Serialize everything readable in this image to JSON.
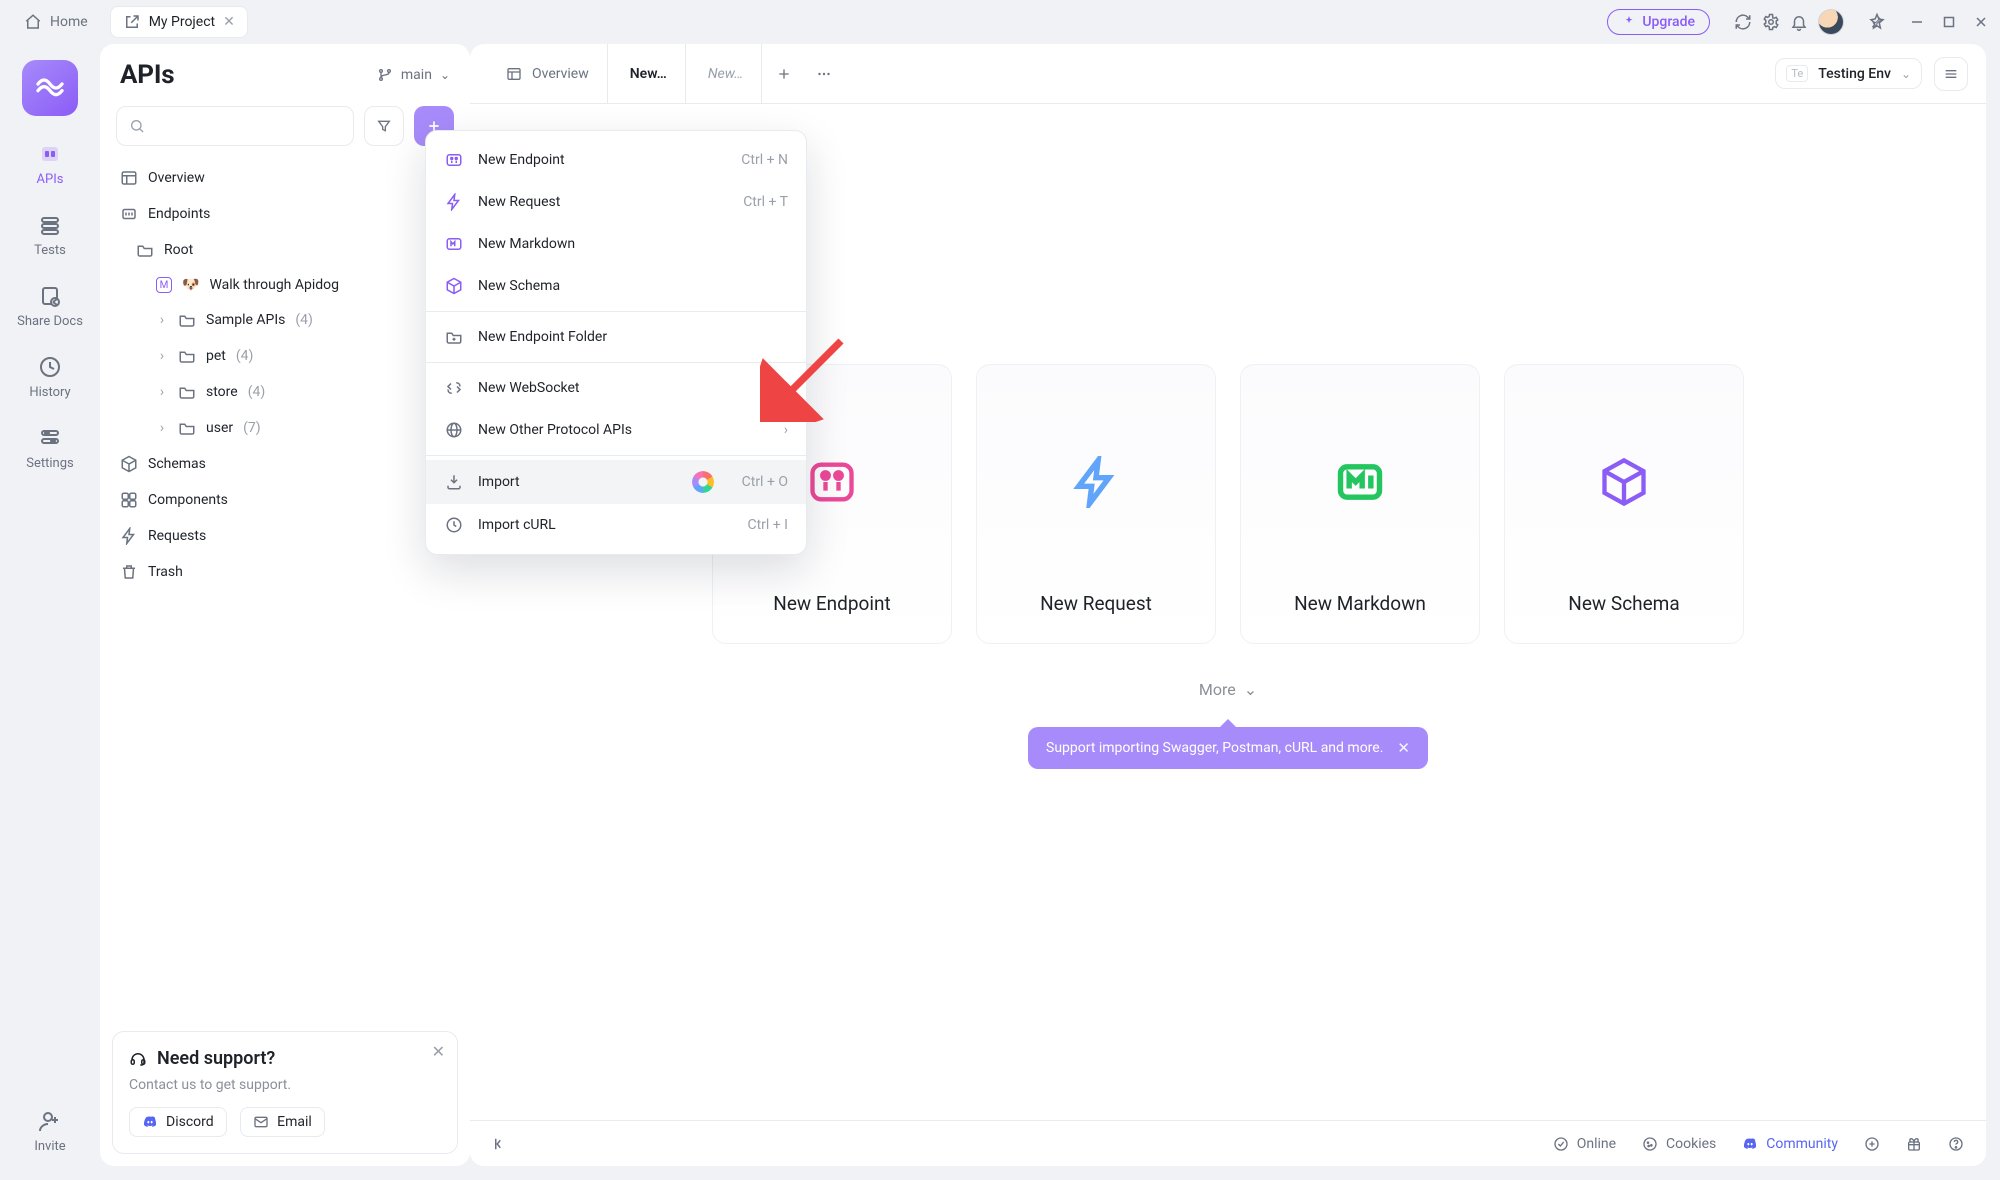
{
  "titlebar": {
    "home": "Home",
    "project_tab": "My Project",
    "upgrade": "Upgrade"
  },
  "leftrail": {
    "apis": "APIs",
    "tests": "Tests",
    "share_docs": "Share Docs",
    "history": "History",
    "settings": "Settings",
    "invite": "Invite"
  },
  "left_panel": {
    "title": "APIs",
    "branch": "main",
    "overview": "Overview",
    "endpoints": "Endpoints",
    "root": "Root",
    "walk_item": "Walk through Apidog",
    "folders": [
      {
        "name": "Sample APIs",
        "count": "(4)"
      },
      {
        "name": "pet",
        "count": "(4)"
      },
      {
        "name": "store",
        "count": "(4)"
      },
      {
        "name": "user",
        "count": "(7)"
      }
    ],
    "schemas": "Schemas",
    "components": "Components",
    "requests": "Requests",
    "trash": "Trash"
  },
  "support": {
    "title": "Need support?",
    "text": "Contact us to get support.",
    "discord": "Discord",
    "email": "Email"
  },
  "right_panel": {
    "tab_overview": "Overview",
    "tab_active": "New…",
    "tab_ghost": "New…",
    "env_short": "Te",
    "env_name": "Testing Env"
  },
  "tiles": {
    "endpoint": "New Endpoint",
    "request": "New Request",
    "markdown": "New Markdown",
    "schema": "New Schema",
    "more": "More"
  },
  "tooltip": "Support importing Swagger, Postman, cURL and more.",
  "dropdown": {
    "new_endpoint": {
      "label": "New Endpoint",
      "shortcut": "Ctrl + N"
    },
    "new_request": {
      "label": "New Request",
      "shortcut": "Ctrl + T"
    },
    "new_markdown": {
      "label": "New Markdown"
    },
    "new_schema": {
      "label": "New Schema"
    },
    "new_folder": {
      "label": "New Endpoint Folder"
    },
    "new_ws": {
      "label": "New WebSocket"
    },
    "new_other": {
      "label": "New Other Protocol APIs"
    },
    "import": {
      "label": "Import",
      "shortcut": "Ctrl + O"
    },
    "import_curl": {
      "label": "Import cURL",
      "shortcut": "Ctrl + I"
    }
  },
  "statusbar": {
    "online": "Online",
    "cookies": "Cookies",
    "community": "Community"
  }
}
